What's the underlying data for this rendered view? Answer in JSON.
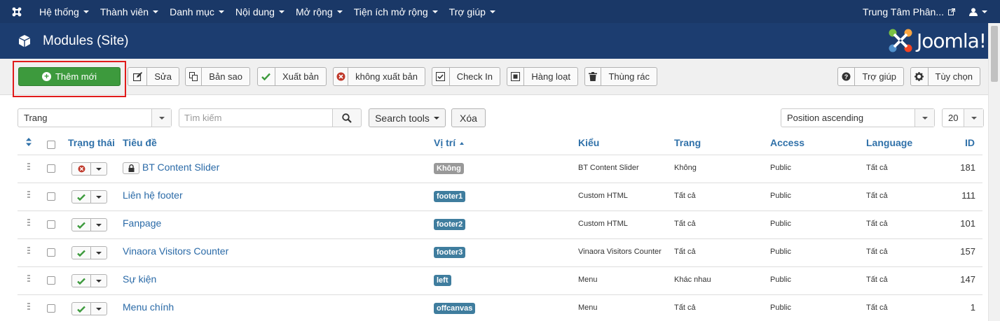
{
  "navbar": {
    "items": [
      {
        "label": "Hệ thống"
      },
      {
        "label": "Thành viên"
      },
      {
        "label": "Danh mục"
      },
      {
        "label": "Nội dung"
      },
      {
        "label": "Mở rộng"
      },
      {
        "label": "Tiện ích mở rộng"
      },
      {
        "label": "Trợ giúp"
      }
    ],
    "site_link": "Trung Tâm Phân...",
    "icons": {
      "logo": "joomla-logo-icon",
      "external": "external-link-icon",
      "user": "user-icon"
    }
  },
  "header": {
    "title": "Modules (Site)",
    "brand": "Joomla!",
    "icon": "cube-icon"
  },
  "toolbar": {
    "new_label": "Thêm mới",
    "edit_label": "Sửa",
    "copy_label": "Bản sao",
    "publish_label": "Xuất bản",
    "unpublish_label": "không xuất bản",
    "checkin_label": "Check In",
    "batch_label": "Hàng loạt",
    "trash_label": "Thùng rác",
    "help_label": "Trợ giúp",
    "options_label": "Tùy chọn"
  },
  "filters": {
    "client_select": "Trang",
    "search_placeholder": "Tìm kiếm",
    "search_tools_label": "Search tools",
    "clear_label": "Xóa",
    "ordering_select": "Position ascending",
    "limit_select": "20"
  },
  "table": {
    "headers": {
      "status": "Trạng thái",
      "title": "Tiêu đề",
      "position": "Vị trí",
      "type": "Kiểu",
      "pages": "Trang",
      "access": "Access",
      "language": "Language",
      "id": "ID"
    },
    "rows": [
      {
        "state": "unpublished",
        "locked": true,
        "title": "BT Content Slider",
        "position": "Không",
        "type": "BT Content Slider",
        "pages": "Không",
        "access": "Public",
        "language": "Tất cả",
        "id": "181"
      },
      {
        "state": "published",
        "locked": false,
        "title": "Liên hệ footer",
        "position": "footer1",
        "type": "Custom HTML",
        "pages": "Tất cả",
        "access": "Public",
        "language": "Tất cả",
        "id": "111"
      },
      {
        "state": "published",
        "locked": false,
        "title": "Fanpage",
        "position": "footer2",
        "type": "Custom HTML",
        "pages": "Tất cả",
        "access": "Public",
        "language": "Tất cả",
        "id": "101"
      },
      {
        "state": "published",
        "locked": false,
        "title": "Vinaora Visitors Counter",
        "position": "footer3",
        "type": "Vinaora Visitors Counter",
        "pages": "Tất cả",
        "access": "Public",
        "language": "Tất cả",
        "id": "157"
      },
      {
        "state": "published",
        "locked": false,
        "title": "Sự kiện",
        "position": "left",
        "type": "Menu",
        "pages": "Khác nhau",
        "access": "Public",
        "language": "Tất cả",
        "id": "147"
      },
      {
        "state": "published",
        "locked": false,
        "title": "Menu chính",
        "position": "offcanvas",
        "type": "Menu",
        "pages": "Tất cả",
        "access": "Public",
        "language": "Tất cả",
        "id": "1"
      }
    ]
  },
  "colors": {
    "navbar": "#1a3867",
    "header": "#1c3d70",
    "new_button": "#3d9a3d",
    "link": "#2a6aa7",
    "badge_position": "#3f7d9e",
    "badge_none": "#999999",
    "published": "#3c9a3c",
    "unpublished": "#c0392b",
    "highlight": "#e01b1b"
  }
}
